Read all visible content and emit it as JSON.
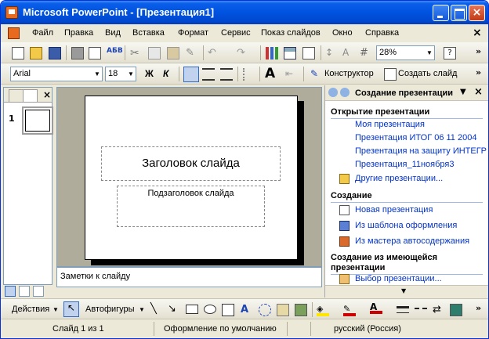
{
  "window": {
    "title": "Microsoft PowerPoint - [Презентация1]"
  },
  "menu": {
    "items": [
      "Файл",
      "Правка",
      "Вид",
      "Вставка",
      "Формат",
      "Сервис",
      "Показ слайдов",
      "Окно",
      "Справка"
    ],
    "close": "×"
  },
  "toolbar_standard": {
    "zoom": "28%"
  },
  "toolbar_format": {
    "font": "Arial",
    "size": "18",
    "bold": "Ж",
    "italic": "К",
    "designer": "Конструктор",
    "new_slide": "Создать слайд"
  },
  "slide": {
    "title_placeholder": "Заголовок слайда",
    "subtitle_placeholder": "Подзаголовок слайда",
    "notes_placeholder": "Заметки к слайду",
    "thumb_number": "1"
  },
  "task_pane": {
    "title": "Создание презентации",
    "sections": [
      {
        "heading": "Открытие презентации",
        "links": [
          "Моя презентация",
          "Презентация ИТОГ 06 11 2004",
          "Презентация на защиту ИНТЕГР",
          "Презентация_11ноября3",
          "Другие презентации..."
        ]
      },
      {
        "heading": "Создание",
        "links": [
          "Новая презентация",
          "Из шаблона оформления",
          "Из мастера автосодержания"
        ]
      },
      {
        "heading": "Создание из имеющейся презентации",
        "links": [
          "Выбор презентации..."
        ]
      }
    ]
  },
  "drawing": {
    "actions": "Действия",
    "autoshapes": "Автофигуры"
  },
  "status": {
    "slide": "Слайд 1 из 1",
    "design": "Оформление по умолчанию",
    "language": "русский (Россия)"
  },
  "colors": {
    "title_bar": "#0052E0",
    "link": "#0033CC",
    "fill_bucket": "#FFE600",
    "line_color": "#CC0000"
  }
}
